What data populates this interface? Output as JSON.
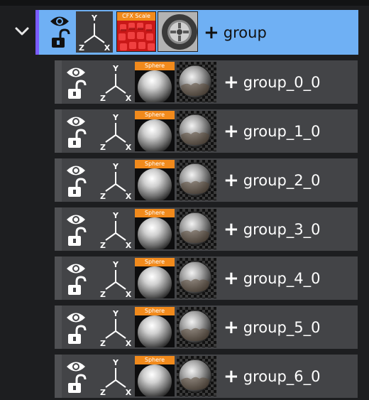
{
  "outliner": {
    "group": {
      "cfx_label": "CFX Scale",
      "axis_labels": {
        "y": "Y",
        "z": "Z",
        "x": "X"
      },
      "plus": "+",
      "name": "group"
    },
    "children": [
      {
        "thumb_label": "Sphere",
        "plus": "+",
        "name": "group_0_0"
      },
      {
        "thumb_label": "Sphere",
        "plus": "+",
        "name": "group_1_0"
      },
      {
        "thumb_label": "Sphere",
        "plus": "+",
        "name": "group_2_0"
      },
      {
        "thumb_label": "Sphere",
        "plus": "+",
        "name": "group_3_0"
      },
      {
        "thumb_label": "Sphere",
        "plus": "+",
        "name": "group_4_0"
      },
      {
        "thumb_label": "Sphere",
        "plus": "+",
        "name": "group_5_0"
      },
      {
        "thumb_label": "Sphere",
        "plus": "+",
        "name": "group_6_0"
      }
    ],
    "child_axis_labels": {
      "y": "Y",
      "z": "Z",
      "x": "X"
    }
  },
  "colors": {
    "background": "#1d1e20",
    "group_row": "#6fb0f4",
    "group_accent": "#7a5cff",
    "child_row": "#434447",
    "thumb_bar": "#f18a1c"
  },
  "icons": [
    "chevron-down-icon",
    "eye-icon",
    "unlock-icon",
    "axis-gizmo-icon",
    "cfx-scale-thumbnail",
    "wheel-thumbnail",
    "sphere-material-thumbnail",
    "environment-map-thumbnail"
  ]
}
